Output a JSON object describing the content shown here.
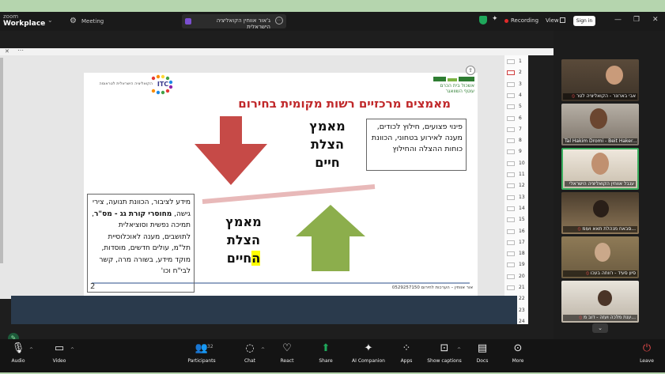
{
  "titlebar": {
    "brand_line1": "zoom",
    "brand_line2": "Workplace",
    "meeting_label": "Meeting",
    "tab_title": "ג'אור אווחין הקואליציה הישראלית",
    "recording_label": "Recording",
    "view_label": "View",
    "signin_label": "Sign in"
  },
  "doc_thumbnails": [
    "1",
    "2",
    "3",
    "4",
    "5",
    "6",
    "7",
    "8",
    "9",
    "10",
    "11",
    "12",
    "13",
    "14",
    "15",
    "16",
    "17",
    "18",
    "19",
    "20",
    "21",
    "22",
    "23",
    "24"
  ],
  "slide": {
    "logo_right_text": "אשכול בית הכרם",
    "logo_right_sub": "עוטף השוואגר",
    "logo_left": "ITC",
    "logo_left_text": "הקואליציה הישראלית לטראומה",
    "title": "מאמצים מרכזיים רשות מקומית בחירום",
    "top_box": "פינוי פצועים, חילוץ לכודים, מענה לאירוע בטחוני, הכוונת כוחות ההצלה והחילוץ",
    "top_label_1": "מאמץ",
    "top_label_2": "הצלת",
    "top_label_3": "חיים",
    "bottom_label_1": "מאמץ",
    "bottom_label_2": "הצלת",
    "bottom_label_3_highlight": "ה",
    "bottom_label_3_rest": "חיים",
    "left_box_1": "מידע לציבור, הכוונת תנועה, צירי גישה,",
    "left_box_bold": "מחוסרי קורת גג - מס\"ר",
    "left_box_2": ", תמיכה נפשית וסוציאלית לתושבים, מענה לאוכלוסיית תל\"מ, עולים חדשים, מוסדות, מוקד מידע, בשורה מרה, קשר לבי\"ח וכו'",
    "page_number": "2",
    "footer": "אור אווחין – הערכות לחירום 0529257150",
    "colors": {
      "title": "#c0282a",
      "down_arrow": "#c64a47",
      "up_arrow": "#8cae4c",
      "highlight": "#ffff00"
    }
  },
  "participants": [
    {
      "name": "אבי בארונר - הקואליציה לטר",
      "muted": true
    },
    {
      "name": "Tal Hakim Dromi - Beit Haker...",
      "muted": false
    },
    {
      "name": "ענבל אווחין הקואליציה הישראלי",
      "muted": false,
      "active": true
    },
    {
      "name": "סבאח מנהלת תאא ועומ...",
      "muted": true
    },
    {
      "name": "סיון סעיד - רווחה בעכו",
      "muted": true
    },
    {
      "name": "ענת מלכה ועזה - דוב מ...",
      "muted": true
    }
  ],
  "toolbar": {
    "audio": "Audio",
    "video": "Video",
    "participants": "Participants",
    "participants_count": "32",
    "chat": "Chat",
    "react": "React",
    "share": "Share",
    "ai": "AI Companion",
    "apps": "Apps",
    "captions": "Show captions",
    "docs": "Docs",
    "more": "More",
    "leave": "Leave"
  }
}
